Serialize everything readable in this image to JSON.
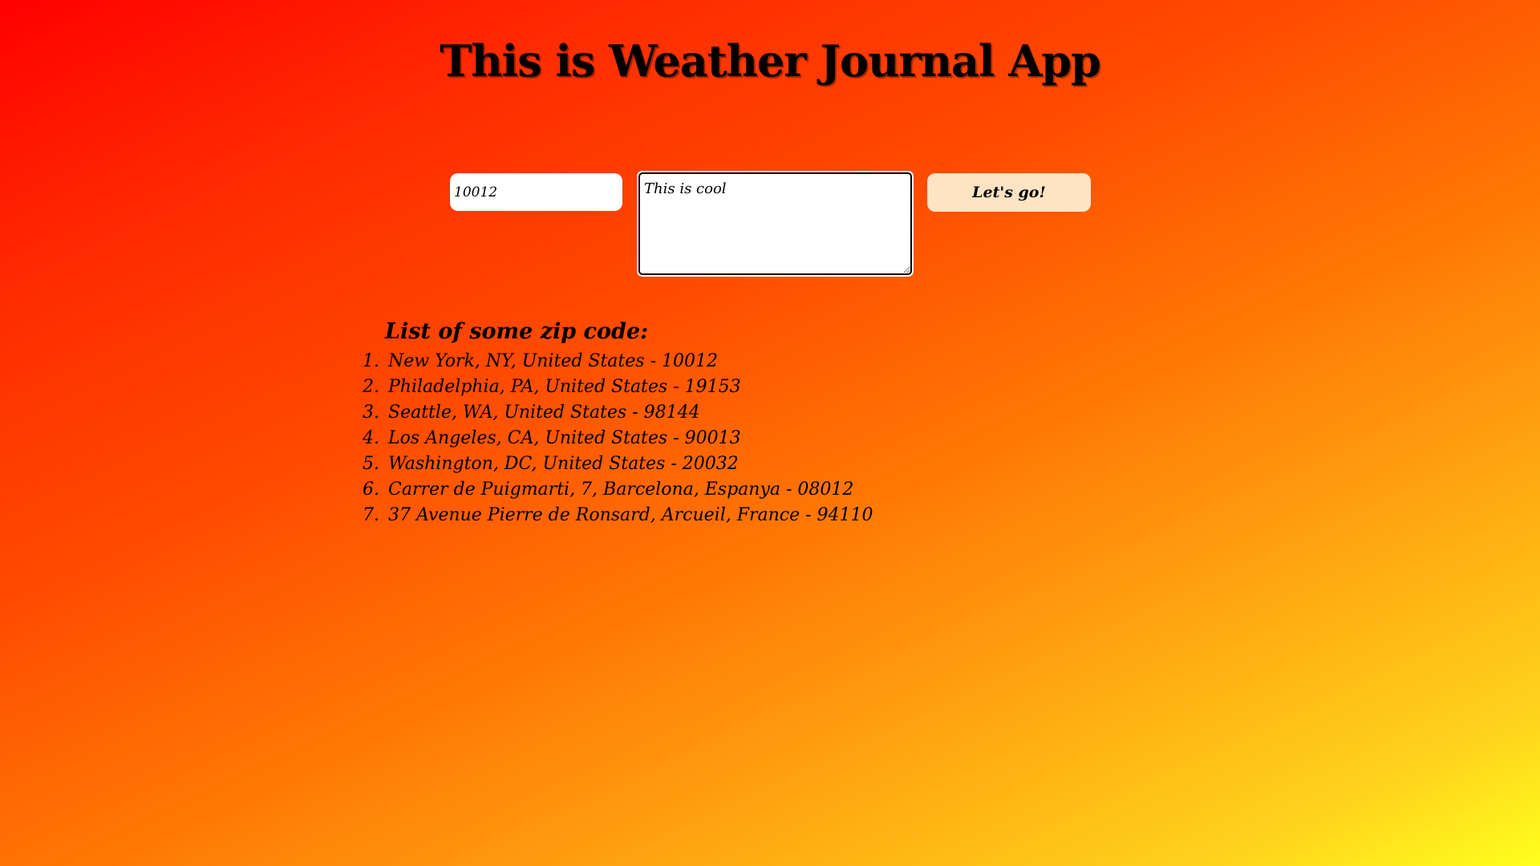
{
  "header": {
    "title": "This is Weather Journal App"
  },
  "form": {
    "zip_value": "10012",
    "feelings_value": "This is cool",
    "generate_label": "Let's go!"
  },
  "zip_list": {
    "heading": "List of some zip code:",
    "items": [
      "New York, NY, United States - 10012",
      "Philadelphia, PA, United States - 19153",
      "Seattle, WA, United States - 98144",
      "Los Angeles, CA, United States - 90013",
      "Washington, DC, United States - 20032",
      "Carrer de Puigmarti, 7, Barcelona, Espanya - 08012",
      "37 Avenue Pierre de Ronsard, Arcueil, France - 94110"
    ]
  },
  "colors": {
    "gradient_start": "#ff0000",
    "gradient_end": "#ffff1e",
    "button_bg": "#ffe4c4"
  }
}
